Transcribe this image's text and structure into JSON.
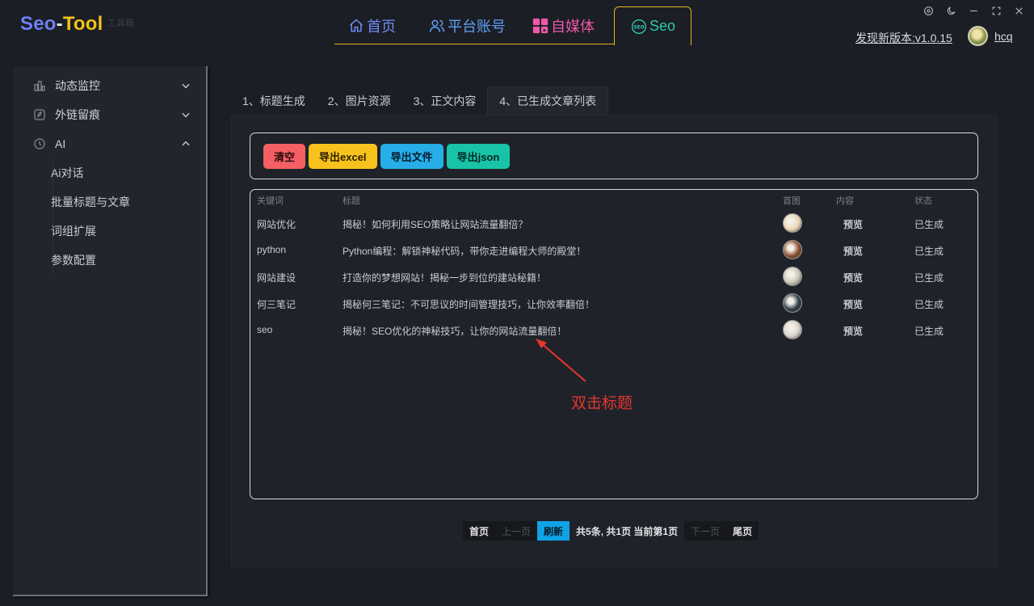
{
  "app": {
    "logo": {
      "part1": "Seo",
      "dash": "-",
      "part2": "Tool"
    },
    "logo_sub": "工具箱"
  },
  "nav": [
    {
      "label": "首页",
      "icon": "home-icon"
    },
    {
      "label": "平台账号",
      "icon": "users-icon"
    },
    {
      "label": "自媒体",
      "icon": "grid-icon"
    },
    {
      "label": "Seo",
      "icon": "seo-icon",
      "active": true
    }
  ],
  "header": {
    "update_text": "发现新版本:v1.0.15",
    "username": "hcq"
  },
  "sidebar": {
    "items": [
      {
        "label": "动态监控",
        "icon": "chart-icon",
        "expanded": false
      },
      {
        "label": "外链留痕",
        "icon": "compass-icon",
        "expanded": false
      },
      {
        "label": "AI",
        "icon": "ai-icon",
        "expanded": true
      }
    ],
    "ai_children": [
      "Ai对话",
      "批量标题与文章",
      "词组扩展",
      "参数配置"
    ]
  },
  "tabs": [
    "1、标题生成",
    "2、图片资源",
    "3、正文内容",
    "4、已生成文章列表"
  ],
  "toolbar": {
    "clear": "清空",
    "export_excel": "导出excel",
    "export_file": "导出文件",
    "export_json": "导出json"
  },
  "table": {
    "headers": [
      "关键词",
      "标题",
      "首图",
      "内容",
      "状态"
    ],
    "rows": [
      {
        "keyword": "网站优化",
        "title": "揭秘！如何利用SEO策略让网站流量翻倍？",
        "content": "预览",
        "status": "已生成",
        "thumb_color": "#e9d4b2"
      },
      {
        "keyword": "python",
        "title": "Python编程：解锁神秘代码，带你走进编程大师的殿堂！",
        "content": "预览",
        "status": "已生成",
        "thumb_color": "#8a4a2a"
      },
      {
        "keyword": "网站建设",
        "title": "打造你的梦想网站！揭秘一步到位的建站秘籍！",
        "content": "预览",
        "status": "已生成",
        "thumb_color": "#c9c4b6"
      },
      {
        "keyword": "何三笔记",
        "title": "揭秘何三笔记：不可思议的时间管理技巧，让你效率翻倍！",
        "content": "预览",
        "status": "已生成",
        "thumb_color": "#2c3a44"
      },
      {
        "keyword": "seo",
        "title": "揭秘！SEO优化的神秘技巧，让你的网站流量翻倍！",
        "content": "预览",
        "status": "已生成",
        "thumb_color": "#d8d2c8"
      }
    ]
  },
  "annotation": {
    "text": "双击标题",
    "color": "#e8352e"
  },
  "pager": {
    "first": "首页",
    "prev": "上一页",
    "refresh": "刷新",
    "info": "共5条, 共1页 当前第1页",
    "next": "下一页",
    "last": "尾页"
  }
}
